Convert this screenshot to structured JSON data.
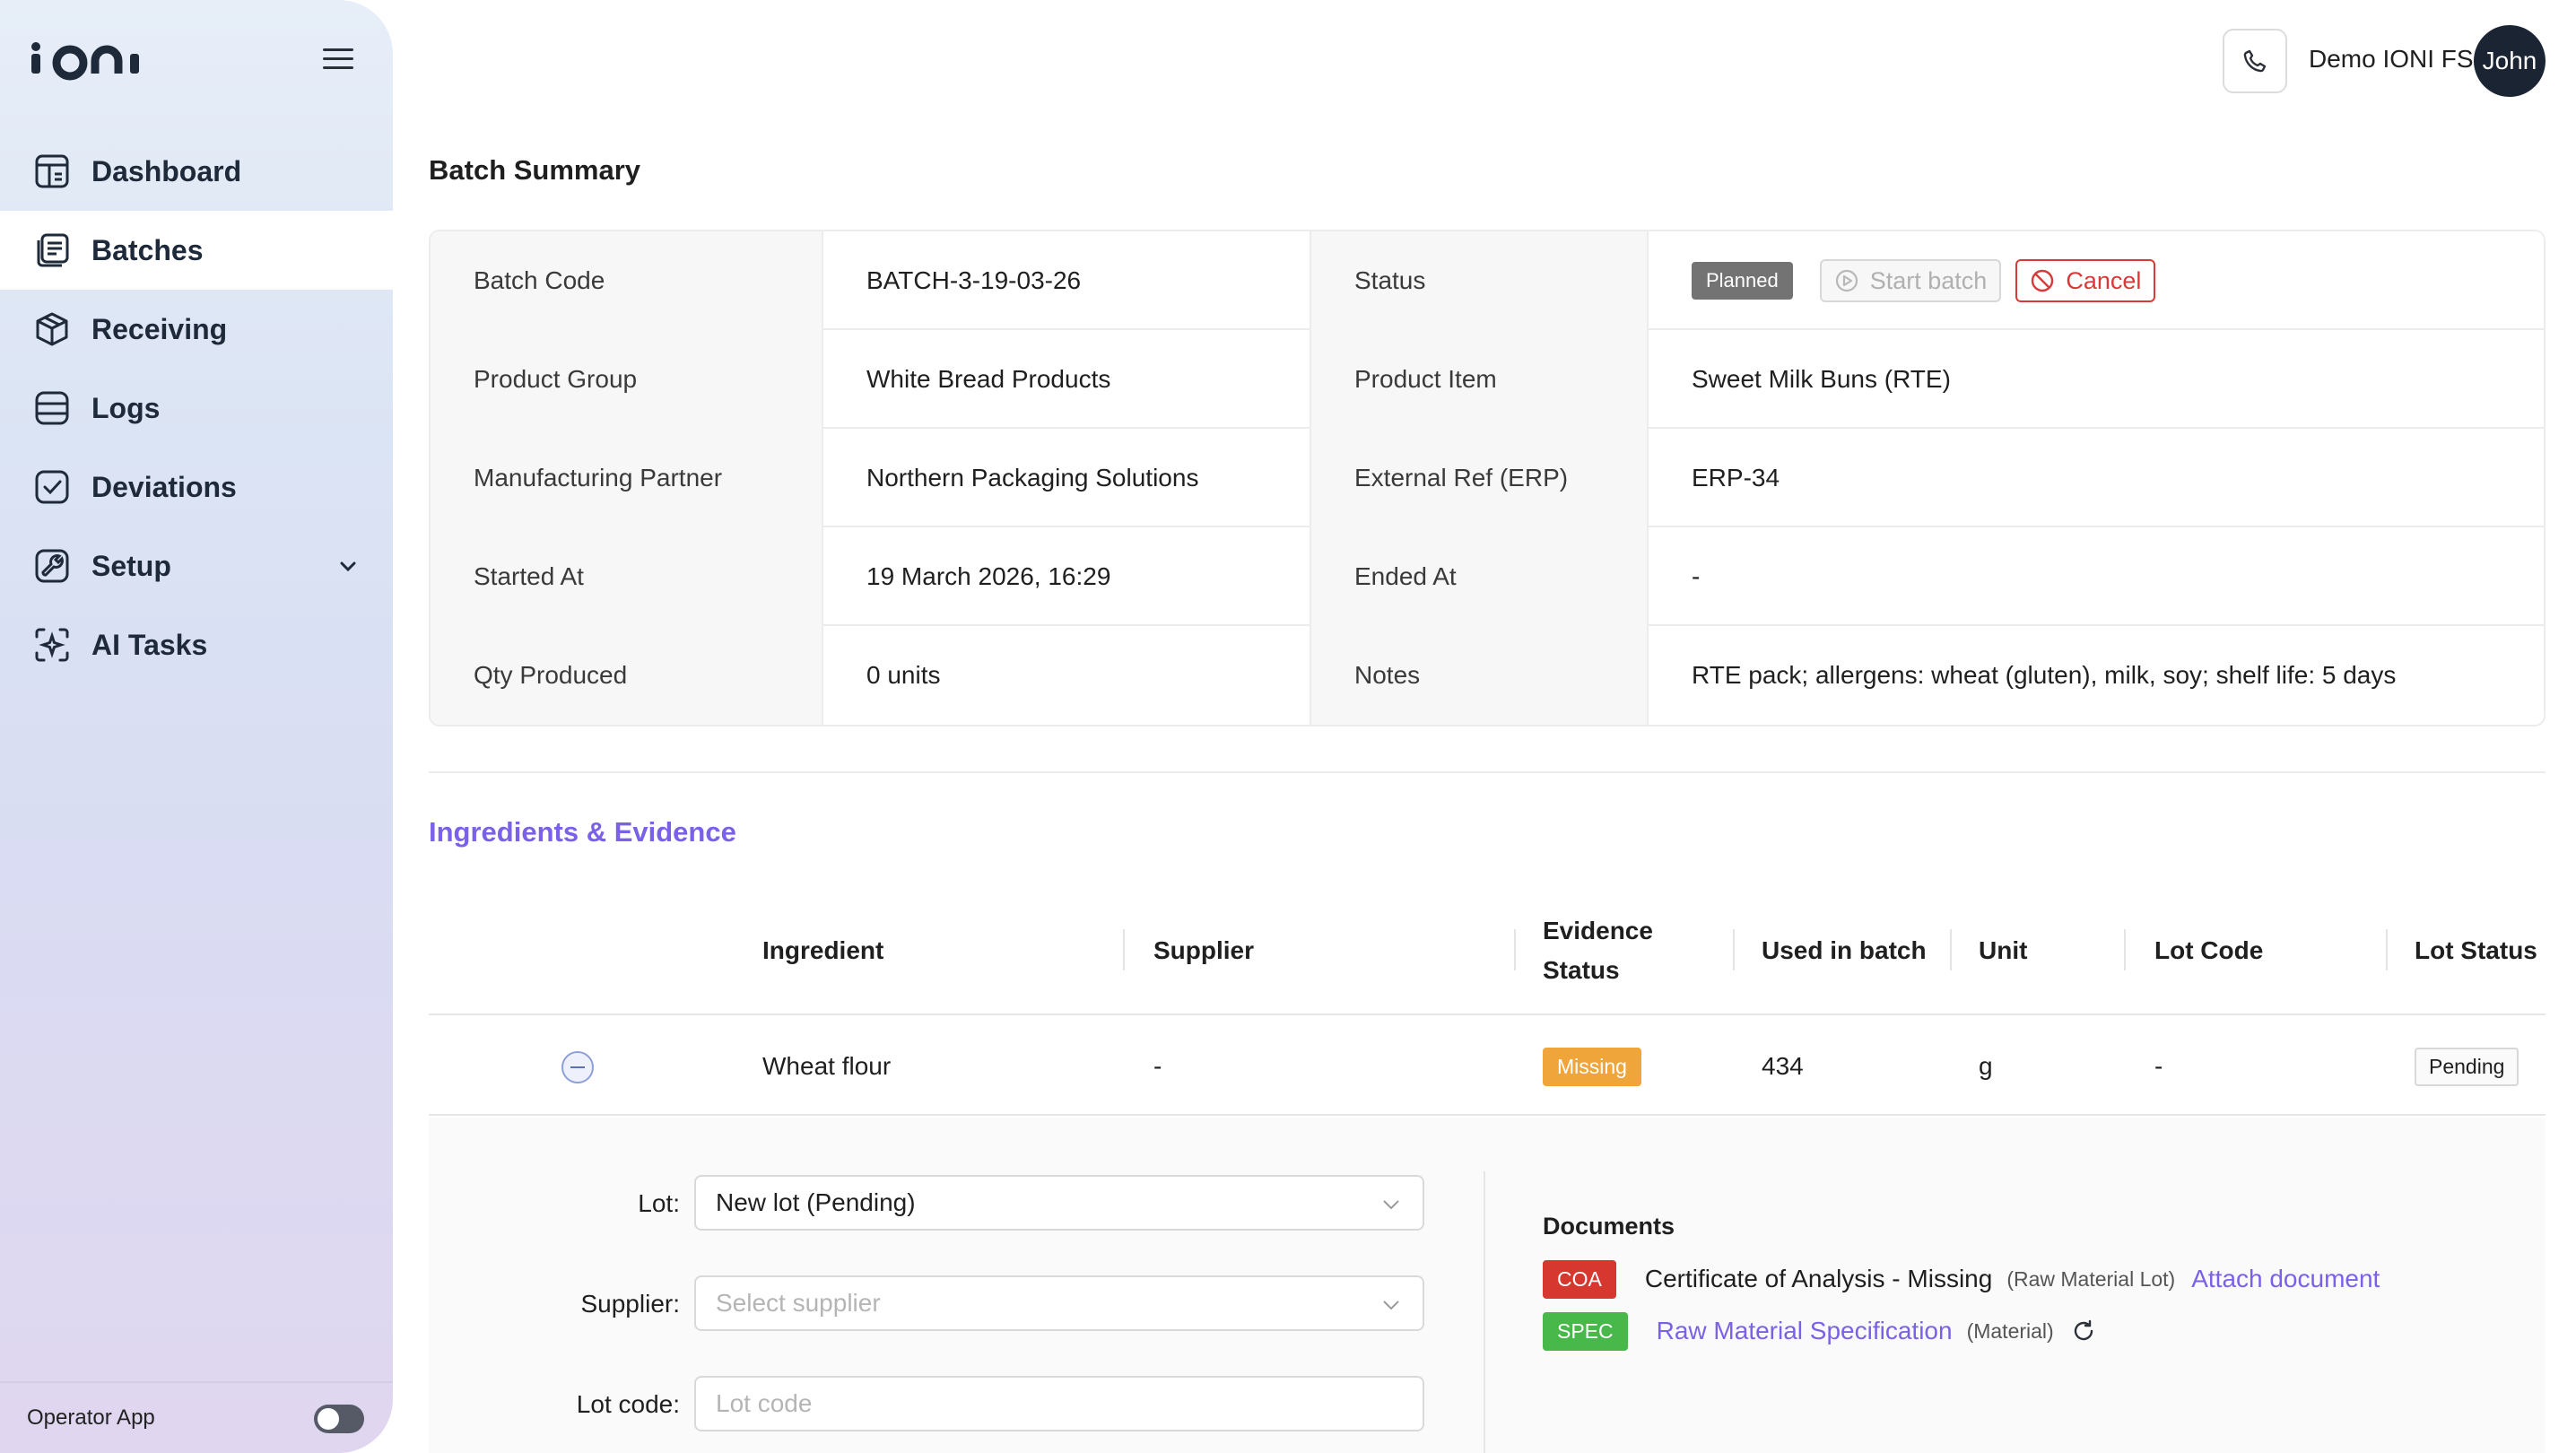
{
  "app": {
    "logo_text": "IONI"
  },
  "sidebar": {
    "items": [
      {
        "label": "Dashboard",
        "icon": "dashboard-icon"
      },
      {
        "label": "Batches",
        "icon": "batches-icon",
        "active": true
      },
      {
        "label": "Receiving",
        "icon": "box-icon"
      },
      {
        "label": "Logs",
        "icon": "logs-icon"
      },
      {
        "label": "Deviations",
        "icon": "check-square-icon"
      },
      {
        "label": "Setup",
        "icon": "wrench-icon",
        "expandable": true
      },
      {
        "label": "AI Tasks",
        "icon": "ai-sparkle-icon"
      }
    ],
    "footer": {
      "label": "Operator App",
      "toggle_on": false
    }
  },
  "header": {
    "user_name": "Demo IONI FS",
    "avatar_text": "John"
  },
  "batch_summary": {
    "title": "Batch Summary",
    "rows": [
      {
        "label1": "Batch Code",
        "value1": "BATCH-3-19-03-26",
        "label2": "Status",
        "value2": ""
      },
      {
        "label1": "Product Group",
        "value1": "White Bread Products",
        "label2": "Product Item",
        "value2": "Sweet Milk Buns (RTE)"
      },
      {
        "label1": "Manufacturing Partner",
        "value1": "Northern Packaging Solutions",
        "label2": "External Ref (ERP)",
        "value2": "ERP-34"
      },
      {
        "label1": "Started At",
        "value1": "19 March 2026, 16:29",
        "label2": "Ended At",
        "value2": "-"
      },
      {
        "label1": "Qty Produced",
        "value1": "0 units",
        "label2": "Notes",
        "value2": "RTE pack; allergens: wheat (gluten), milk, soy; shelf life: 5 days"
      }
    ],
    "status": {
      "badge": "Planned",
      "start_label": "Start batch",
      "cancel_label": "Cancel"
    }
  },
  "ingredients": {
    "title": "Ingredients & Evidence",
    "columns": {
      "ingredient": "Ingredient",
      "supplier": "Supplier",
      "evidence_line1": "Evidence",
      "evidence_line2": "Status",
      "used": "Used in batch",
      "unit": "Unit",
      "lot_code": "Lot Code",
      "lot_status": "Lot Status"
    },
    "rows": [
      {
        "ingredient": "Wheat flour",
        "supplier": "-",
        "evidence_status": "Missing",
        "used": "434",
        "unit": "g",
        "lot_code": "-",
        "lot_status": "Pending"
      }
    ],
    "expanded": {
      "lot_label": "Lot",
      "lot_value": "New lot (Pending)",
      "supplier_label": "Supplier",
      "supplier_placeholder": "Select supplier",
      "lot_code_label": "Lot code",
      "lot_code_placeholder": "Lot code",
      "colon": ":",
      "documents": {
        "title": "Documents",
        "items": [
          {
            "tag": "COA",
            "name": "Certificate of Analysis - Missing",
            "sub": "(Raw Material Lot)",
            "action": "Attach document"
          },
          {
            "tag": "SPEC",
            "name": "Raw Material Specification",
            "sub": "(Material)"
          }
        ]
      }
    }
  },
  "colors": {
    "accent": "#7b61e8",
    "danger": "#d83a3a",
    "warning": "#f0a53a",
    "success": "#49b84a",
    "neutral_badge": "#737373"
  }
}
